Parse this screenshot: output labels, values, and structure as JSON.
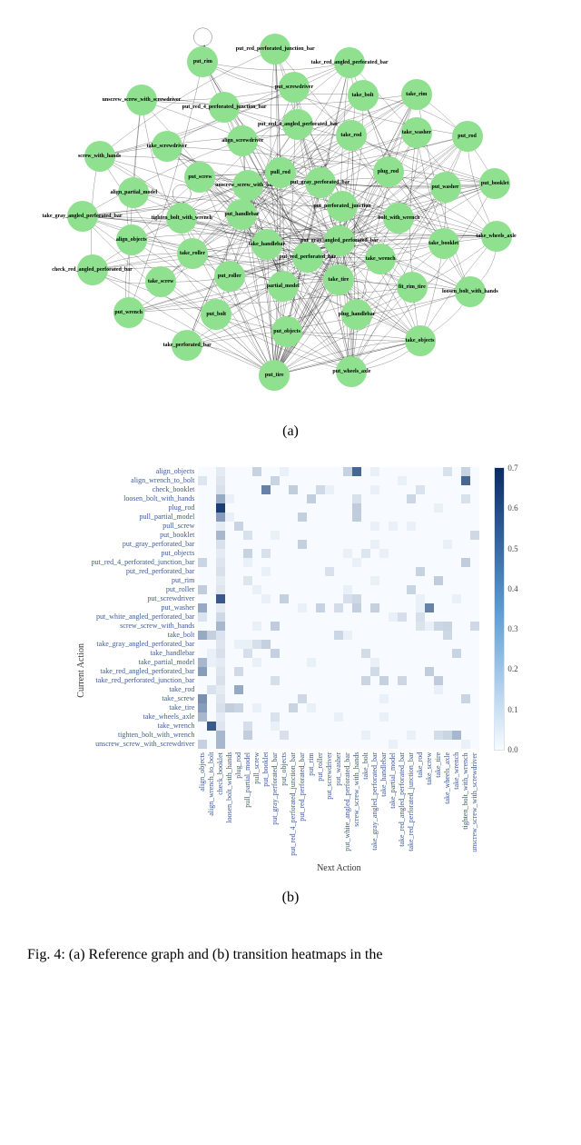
{
  "figure_a": {
    "sub_label": "(a)",
    "node_labels": [
      "put_gray_angled_perforated_bar",
      "put_red_perforated_bar",
      "take_handlebar",
      "put_handlebar",
      "unscrew_screw_with_hands",
      "pull_rod",
      "put_gray_perforated_bar",
      "put_perforated_junction",
      "take_tire",
      "partial_model",
      "put_roller",
      "take_roller",
      "tighten_bolt_with_wrench",
      "put_screw",
      "align_screwdriver",
      "put_red_4_angled_perforated_bar",
      "take_rod",
      "plug_rod",
      "bolt_with_wrench",
      "take_wrench",
      "put_objects",
      "put_bolt",
      "take_screw",
      "align_objects",
      "align_partial_model",
      "take_screwdriver",
      "put_red_4_perforated_junction_bar",
      "put_screwdriver",
      "take_bolt",
      "take_washer",
      "put_washer",
      "take_booklet",
      "fit_rim_tire",
      "plug_handlebar",
      "take_perforated_bar",
      "put_wrench",
      "check_red_angled_perforated_bar",
      "take_gray_angled_perforated_bar",
      "screw_with_hands",
      "unscrew_screw_with_screwdriver",
      "put_rim",
      "put_red_perforated_junction_bar",
      "take_red_angled_perforated_bar",
      "take_rim",
      "put_rod",
      "put_booklet",
      "take_wheels_axle",
      "loosen_bolt_with_hands",
      "take_objects",
      "put_wheels_axle",
      "put_tire"
    ]
  },
  "figure_b": {
    "sub_label": "(b)",
    "y_axis_title": "Current Action",
    "x_axis_title": "Next Action",
    "labels": [
      "align_objects",
      "align_wrench_to_bolt",
      "check_booklet",
      "loosen_bolt_with_hands",
      "plug_rod",
      "pull_partial_model",
      "pull_screw",
      "put_booklet",
      "put_gray_perforated_bar",
      "put_objects",
      "put_red_4_perforated_junction_bar",
      "put_red_perforated_bar",
      "put_rim",
      "put_roller",
      "put_screwdriver",
      "put_washer",
      "put_white_angled_perforated_bar",
      "screw_screw_with_hands",
      "take_bolt",
      "take_gray_angled_perforated_bar",
      "take_handlebar",
      "take_partial_model",
      "take_red_angled_perforated_bar",
      "take_red_perforated_junction_bar",
      "take_rod",
      "take_screw",
      "take_tire",
      "take_wheels_axle",
      "take_wrench",
      "tighten_bolt_with_wrench",
      "unscrew_screw_with_screwdriver"
    ],
    "colorbar_ticks": [
      "0.7",
      "0.6",
      "0.5",
      "0.4",
      "0.3",
      "0.2",
      "0.1",
      "0.0"
    ]
  },
  "caption": "Fig. 4: (a) Reference graph and (b) transition heatmaps in the",
  "chart_data": {
    "type": "heatmap",
    "title": "",
    "xlabel": "Next Action",
    "ylabel": "Current Action",
    "categories": [
      "align_objects",
      "align_wrench_to_bolt",
      "check_booklet",
      "loosen_bolt_with_hands",
      "plug_rod",
      "pull_partial_model",
      "pull_screw",
      "put_booklet",
      "put_gray_perforated_bar",
      "put_objects",
      "put_red_4_perforated_junction_bar",
      "put_red_perforated_bar",
      "put_rim",
      "put_roller",
      "put_screwdriver",
      "put_washer",
      "put_white_angled_perforated_bar",
      "screw_screw_with_hands",
      "take_bolt",
      "take_gray_angled_perforated_bar",
      "take_handlebar",
      "take_partial_model",
      "take_red_angled_perforated_bar",
      "take_red_perforated_junction_bar",
      "take_rod",
      "take_screw",
      "take_tire",
      "take_wheels_axle",
      "take_wrench",
      "tighten_bolt_with_wrench",
      "unscrew_screw_with_screwdriver"
    ],
    "value_range": [
      0.0,
      0.75
    ],
    "notable_cells": [
      {
        "row": "align_objects",
        "col": "screw_screw_with_hands",
        "value": 0.55
      },
      {
        "row": "align_wrench_to_bolt",
        "col": "tighten_bolt_with_wrench",
        "value": 0.55
      },
      {
        "row": "check_booklet",
        "col": "put_booklet",
        "value": 0.45
      },
      {
        "row": "loosen_bolt_with_hands",
        "col": "check_booklet",
        "value": 0.3
      },
      {
        "row": "plug_rod",
        "col": "check_booklet",
        "value": 0.7
      },
      {
        "row": "pull_partial_model",
        "col": "check_booklet",
        "value": 0.35
      },
      {
        "row": "put_booklet",
        "col": "check_booklet",
        "value": 0.25
      },
      {
        "row": "put_screwdriver",
        "col": "check_booklet",
        "value": 0.6
      },
      {
        "row": "put_washer",
        "col": "align_objects",
        "value": 0.3
      },
      {
        "row": "put_washer",
        "col": "take_screw",
        "value": 0.45
      },
      {
        "row": "screw_screw_with_hands",
        "col": "check_booklet",
        "value": 0.25
      },
      {
        "row": "take_bolt",
        "col": "align_objects",
        "value": 0.3
      },
      {
        "row": "take_partial_model",
        "col": "align_objects",
        "value": 0.25
      },
      {
        "row": "take_red_angled_perforated_bar",
        "col": "align_objects",
        "value": 0.35
      },
      {
        "row": "take_rod",
        "col": "plug_rod",
        "value": 0.3
      },
      {
        "row": "take_screw",
        "col": "align_objects",
        "value": 0.4
      },
      {
        "row": "take_tire",
        "col": "align_objects",
        "value": 0.35
      },
      {
        "row": "take_wheels_axle",
        "col": "align_objects",
        "value": 0.25
      },
      {
        "row": "take_wrench",
        "col": "align_wrench_to_bolt",
        "value": 0.6
      },
      {
        "row": "tighten_bolt_with_wrench",
        "col": "check_booklet",
        "value": 0.25
      },
      {
        "row": "tighten_bolt_with_wrench",
        "col": "take_wrench",
        "value": 0.25
      },
      {
        "row": "unscrew_screw_with_screwdriver",
        "col": "check_booklet",
        "value": 0.25
      }
    ]
  }
}
